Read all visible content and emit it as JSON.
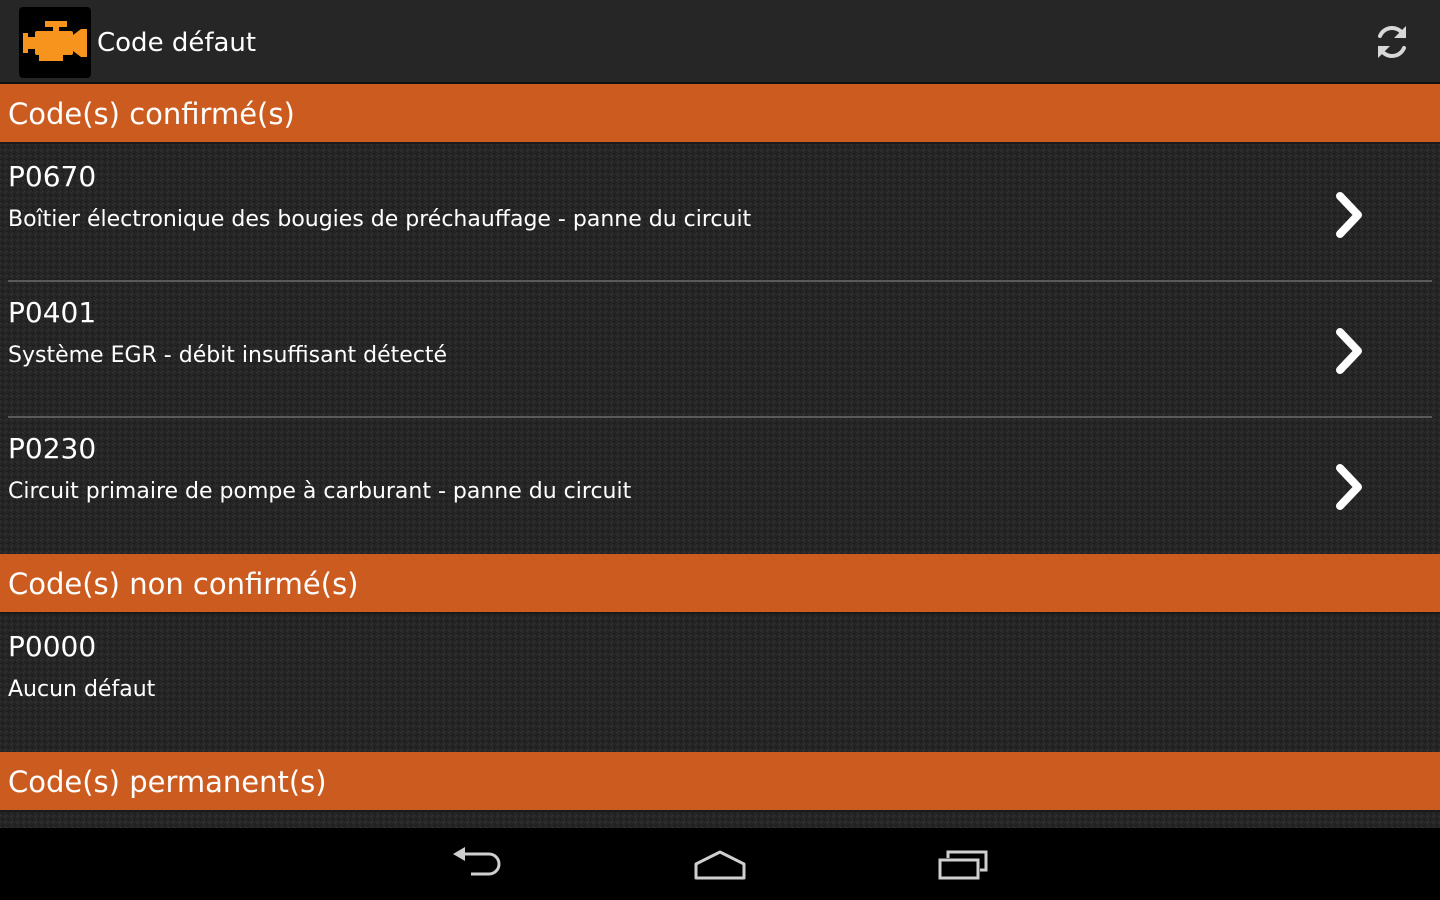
{
  "app": {
    "title": "Code défaut",
    "icon": "check-engine-icon",
    "accent_color": "#cc5b1f",
    "icon_color": "#f7941d"
  },
  "sections": {
    "confirmed": {
      "label": "Code(s) confirmé(s)",
      "items": [
        {
          "code": "P0670",
          "description": "Boîtier électronique des bougies de préchauffage - panne du circuit"
        },
        {
          "code": "P0401",
          "description": "Système EGR - débit insuffisant détecté"
        },
        {
          "code": "P0230",
          "description": "Circuit primaire de pompe à carburant - panne du circuit"
        }
      ]
    },
    "unconfirmed": {
      "label": "Code(s) non confirmé(s)",
      "items": [
        {
          "code": "P0000",
          "description": "Aucun défaut"
        }
      ]
    },
    "permanent": {
      "label": "Code(s) permanent(s)"
    }
  },
  "toolbar": {
    "refresh_icon": "refresh-icon"
  },
  "navbar": {
    "back_icon": "back-icon",
    "home_icon": "home-icon",
    "recents_icon": "recent-apps-icon"
  }
}
